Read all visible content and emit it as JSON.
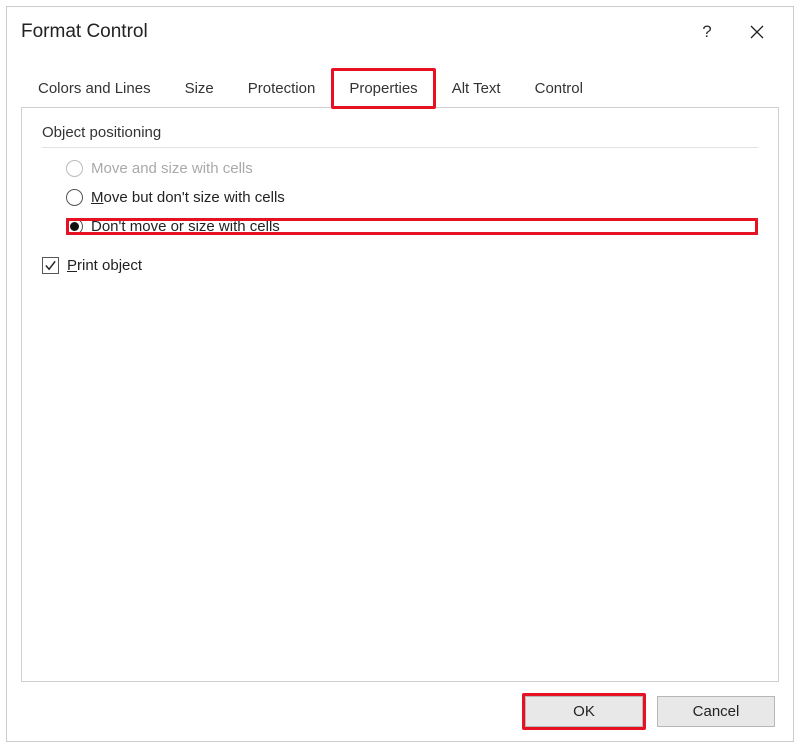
{
  "dialog": {
    "title": "Format Control"
  },
  "tabs": {
    "items": [
      {
        "label": "Colors and Lines"
      },
      {
        "label": "Size"
      },
      {
        "label": "Protection"
      },
      {
        "label": "Properties"
      },
      {
        "label": "Alt Text"
      },
      {
        "label": "Control"
      }
    ]
  },
  "properties": {
    "section_title": "Object positioning",
    "radios": {
      "move_size": "Move and size with cells",
      "move_only_pre": "M",
      "move_only_rest": "ove but don't size with cells",
      "dont_move_pre": "D",
      "dont_move_rest": "on't move or size with cells"
    },
    "print_pre": "P",
    "print_rest": "rint object"
  },
  "buttons": {
    "ok": "OK",
    "cancel": "Cancel"
  }
}
